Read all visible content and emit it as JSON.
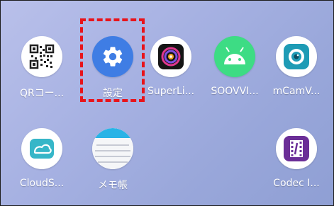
{
  "apps": [
    {
      "label": "QRコー..."
    },
    {
      "label": "設定"
    },
    {
      "label": "SuperLi..."
    },
    {
      "label": "SOOVVI..."
    },
    {
      "label": "mCamV..."
    },
    {
      "label": "CloudS..."
    },
    {
      "label": "メモ帳"
    },
    {
      "label": "Codec I..."
    }
  ],
  "icons": {
    "qr": "qr-code-icon",
    "settings": "gear-icon",
    "superlive": "camera-lens-icon",
    "soovvi": "android-icon",
    "mcam": "eye-camera-icon",
    "cloud": "cloud-icon",
    "memo": "notepad-icon",
    "codec": "film-icon"
  },
  "colors": {
    "wallpaper": "#a6b1e2",
    "highlight": "#e8141b",
    "settings_blue": "#3f7de4",
    "android_green": "#3ddc84",
    "mcam_teal": "#1e9bb5",
    "codec_purple": "#6b2e97"
  }
}
